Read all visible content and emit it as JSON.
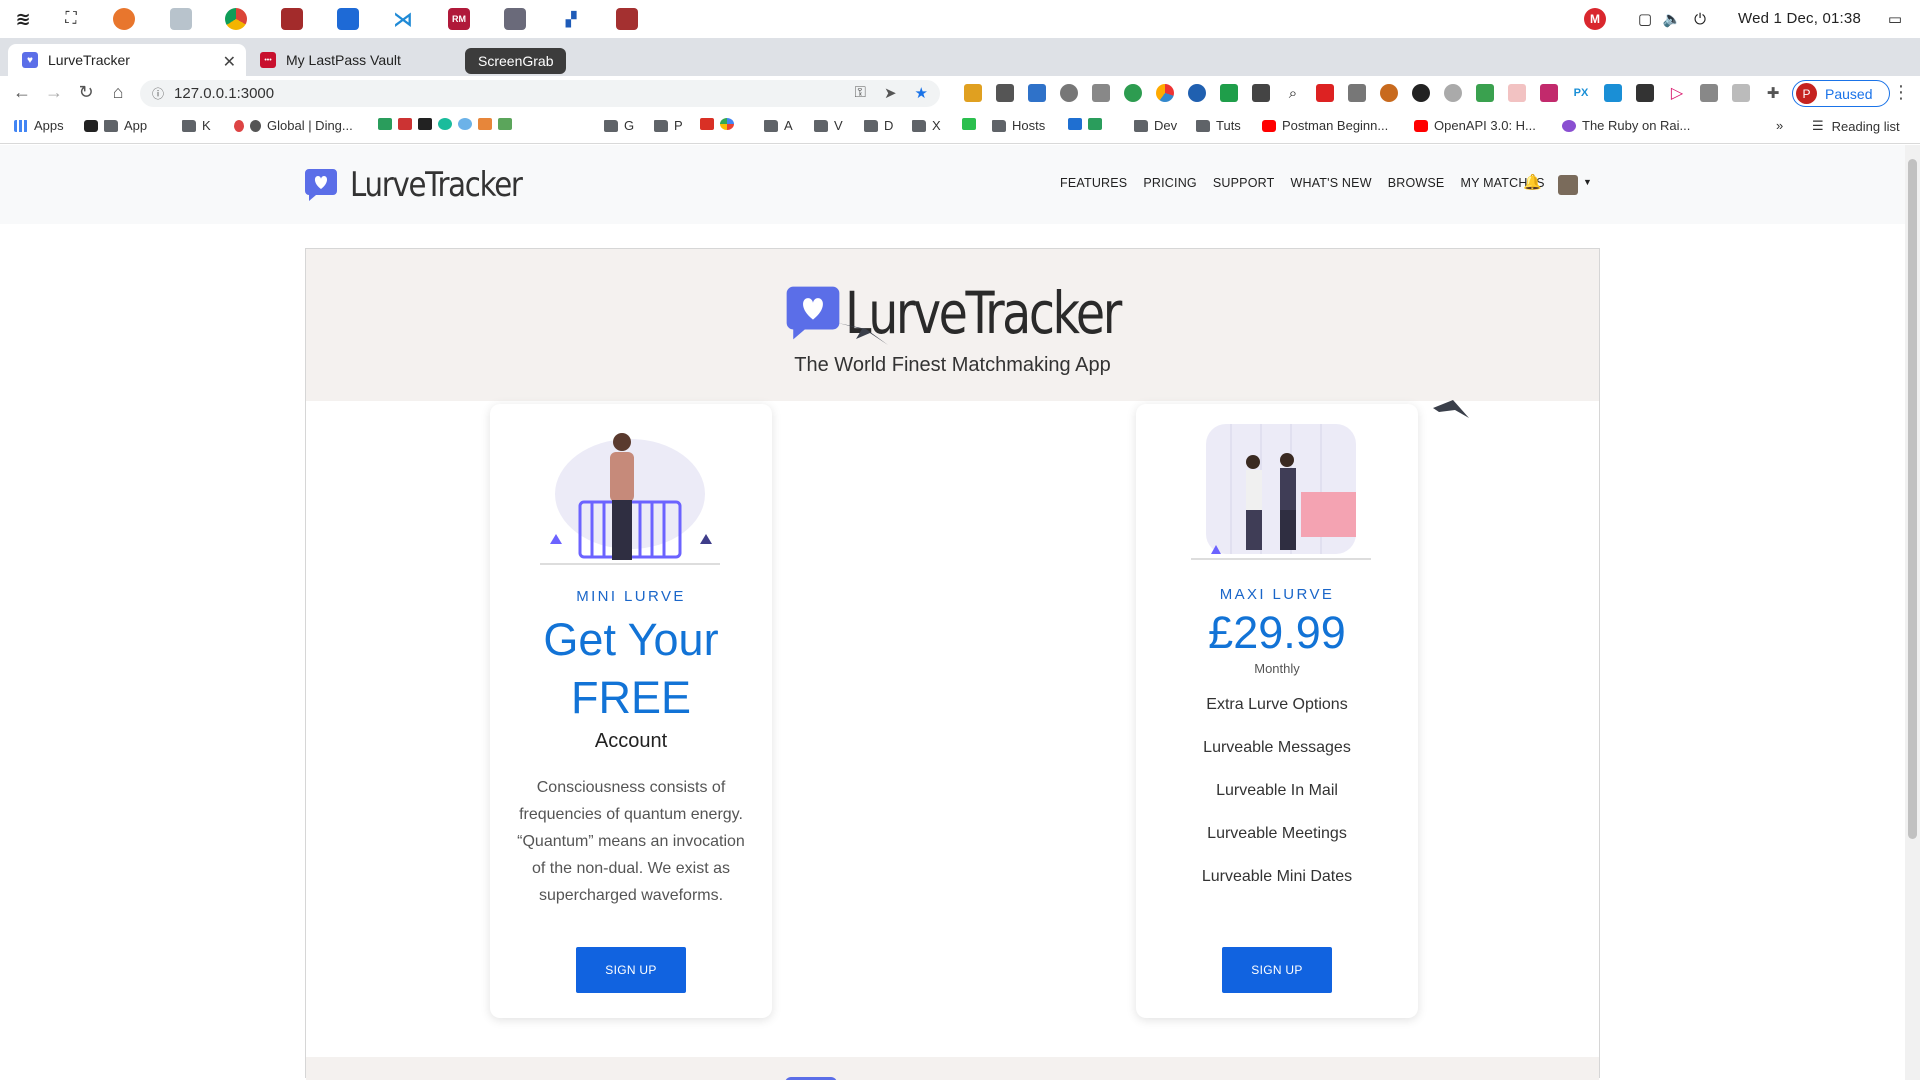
{
  "os": {
    "clock": "Wed 1 Dec, 01:38"
  },
  "browser": {
    "tabs": [
      {
        "title": "LurveTracker"
      },
      {
        "title": "My LastPass Vault"
      }
    ],
    "tooltip": "ScreenGrab",
    "url": "127.0.0.1:3000",
    "profile_status": "Paused",
    "profile_initial": "P",
    "bookmarks": [
      {
        "label": "Apps",
        "icon": "apps-grid-icon"
      },
      {
        "label": "App",
        "icon": "folder-icon"
      },
      {
        "label": "K",
        "icon": "folder-icon"
      },
      {
        "label": "Global | Ding...",
        "icon": "globe-icon"
      },
      {
        "label": "G",
        "icon": "folder-icon"
      },
      {
        "label": "P",
        "icon": "folder-icon"
      },
      {
        "label": "A",
        "icon": "folder-icon"
      },
      {
        "label": "V",
        "icon": "folder-icon"
      },
      {
        "label": "D",
        "icon": "folder-icon"
      },
      {
        "label": "X",
        "icon": "folder-icon"
      },
      {
        "label": "Hosts",
        "icon": "folder-icon"
      },
      {
        "label": "Dev",
        "icon": "folder-icon"
      },
      {
        "label": "Tuts",
        "icon": "folder-icon"
      },
      {
        "label": "Postman Beginn...",
        "icon": "youtube-icon"
      },
      {
        "label": "OpenAPI 3.0: H...",
        "icon": "youtube-icon"
      },
      {
        "label": "The Ruby on Rai...",
        "icon": "site-icon"
      }
    ],
    "reading_list": "Reading list"
  },
  "site": {
    "brand": "LurveTracker",
    "nav": [
      "FEATURES",
      "PRICING",
      "SUPPORT",
      "WHAT'S NEW",
      "BROWSE",
      "MY MATCHES"
    ],
    "hero": {
      "brand": "LurveTracker",
      "tagline": "The World Finest Matchmaking App"
    },
    "cards": {
      "mini": {
        "kicker": "MINI LURVE",
        "headline_1": "Get Your",
        "headline_2": "FREE",
        "subhead": "Account",
        "description": "Consciousness consists of frequencies of quantum energy. “Quantum” means an invocation of the non-dual. We exist as supercharged waveforms.",
        "cta": "SIGN UP"
      },
      "maxi": {
        "kicker": "MAXI LURVE",
        "price": "£29.99",
        "period": "Monthly",
        "features": [
          "Extra Lurve Options",
          "Lurveable Messages",
          "Lurveable In Mail",
          "Lurveable Meetings",
          "Lurveable Mini Dates"
        ],
        "cta": "SIGN UP"
      }
    }
  },
  "colors": {
    "accent": "#1273d6",
    "button": "#1163e0",
    "logo": "#5b6ee8",
    "hero_bg": "#f4f1ef"
  }
}
